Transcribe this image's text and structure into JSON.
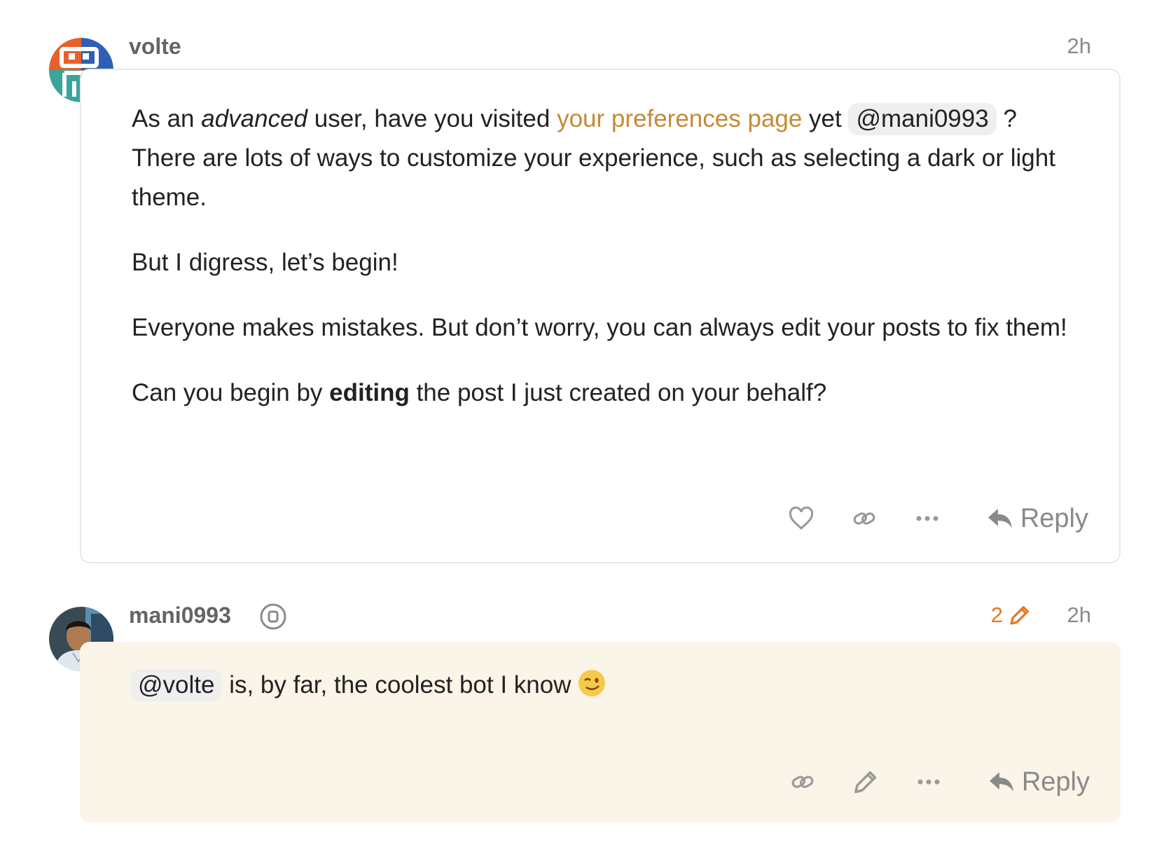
{
  "posts": [
    {
      "username": "volte",
      "time": "2h",
      "body": {
        "p1_a": "As an ",
        "p1_em": "advanced",
        "p1_b": " user, have you visited ",
        "p1_link": "your preferences page",
        "p1_c": " yet ",
        "p1_mention": "@mani0993",
        "p1_d": " ? There are lots of ways to customize your experience, such as selecting a dark or light theme.",
        "p2": "But I digress, let’s begin!",
        "p3": "Everyone makes mistakes. But don’t worry, you can always edit your posts to fix them!",
        "p4_a": "Can you begin by ",
        "p4_strong": "editing",
        "p4_b": " the post I just created on your behalf?"
      },
      "actions": [
        "heart-icon",
        "link-icon",
        "more-icon"
      ],
      "reply_label": "Reply"
    },
    {
      "username": "mani0993",
      "time": "2h",
      "edit_count": "2",
      "body": {
        "mention": "@volte",
        "text": " is, by far, the coolest bot I know"
      },
      "actions": [
        "link-icon",
        "pencil-icon",
        "more-icon"
      ],
      "reply_label": "Reply"
    }
  ],
  "colors": {
    "link": "#c58a34",
    "edit_badge": "#e8761f",
    "highlight_bg": "#fbf4e8"
  }
}
